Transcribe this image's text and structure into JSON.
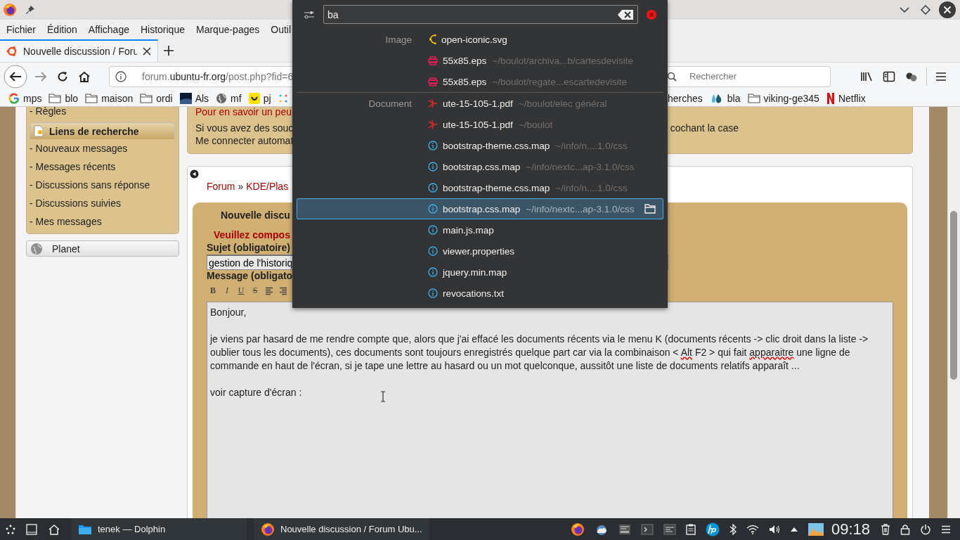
{
  "menu": [
    "Fichier",
    "Édition",
    "Affichage",
    "Historique",
    "Marque-pages",
    "Outil"
  ],
  "tabs": [
    {
      "label": "Nouvelle discussion / Foru",
      "selected": true
    }
  ],
  "address": {
    "prefix": "forum.",
    "host": "ubuntu-fr.org",
    "path": "/post.php?fid=6"
  },
  "search": {
    "placeholder": "Rechercher"
  },
  "bookmarks": {
    "left": [
      {
        "label": "mps",
        "kind": "google"
      },
      {
        "label": "blo",
        "kind": "folder"
      },
      {
        "label": "maison",
        "kind": "folder"
      },
      {
        "label": "ordi",
        "kind": "folder"
      },
      {
        "label": "Als",
        "kind": "image"
      },
      {
        "label": "mf",
        "kind": "globe"
      },
      {
        "label": "pj",
        "kind": "smiley"
      },
      {
        "kind": "app"
      }
    ],
    "right": [
      {
        "label": "herches",
        "kind": "none"
      },
      {
        "label": "bla",
        "kind": "drops"
      },
      {
        "label": "viking-ge345",
        "kind": "folder"
      },
      {
        "label": "Netflix",
        "kind": "netflix"
      }
    ]
  },
  "sidebar": {
    "top_item": "- Règles",
    "header": "Liens de recherche",
    "links": [
      "- Nouveaux messages",
      "- Messages récents",
      "- Discussions sans réponse",
      "- Discussions suivies",
      "- Mes messages"
    ],
    "planet": "Planet"
  },
  "notice": {
    "link": "Pour en savoir un peu",
    "line_1": "Si vous avez des souc",
    "line_1_end": "cochant la case",
    "line_2": "Me connecter automat"
  },
  "breadcrumb": {
    "forum": "Forum",
    "separator": "»",
    "section": "KDE/Plas"
  },
  "form": {
    "title": "Nouvelle discu",
    "warning": "Veuillez compos",
    "subject_label": "Sujet (obligatoire)",
    "subject": "gestion de l'historiq",
    "message_label": "Message (obligato",
    "toolbar": [
      {
        "kind": "bold",
        "label": "B"
      },
      {
        "kind": "italic",
        "label": "I"
      },
      {
        "kind": "underline",
        "label": "U"
      },
      {
        "kind": "strike",
        "label": "S"
      },
      {
        "kind": "align-left"
      },
      {
        "kind": "align-right"
      }
    ],
    "message": [
      [
        {
          "text": "Bonjour,",
          "misspelled": false
        }
      ],
      [
        {
          "text": "je viens par hasard de me rendre compte que, alors que j'ai effacé les documents récents via le menu K (documents récents -> clic droit dans la liste -> oublier tous les documents), ces documents sont toujours enregistrés quelque part car via la combinaison < ",
          "misspelled": false
        },
        {
          "text": "Alt",
          "misspelled": true
        },
        {
          "text": " F2 > qui fait ",
          "misspelled": false
        },
        {
          "text": "apparaitre",
          "misspelled": true
        },
        {
          "text": " une ligne de commande en haut de l'écran, si je tape une lettre au hasard ou un mot quelconque, aussitôt une liste de documents relatifs  apparaît ...",
          "misspelled": false
        }
      ],
      [
        {
          "text": "voir capture d'écran :",
          "misspelled": false
        }
      ]
    ]
  },
  "runner": {
    "query": "ba",
    "groups": [
      {
        "category": "Image",
        "results": [
          {
            "name": "open-iconic.svg",
            "kind": "vector",
            "selected": false
          },
          {
            "name": "55x85.eps",
            "path": "~/boulot/archiva...b/cartesdevisite",
            "kind": "print",
            "selected": false
          },
          {
            "name": "55x85.eps",
            "path": "~/boulot/regate...escartedevisite",
            "kind": "print",
            "selected": false
          }
        ]
      },
      {
        "category": "Document",
        "results": [
          {
            "name": "ute-15-105-1.pdf",
            "path": "~/boulot/elec général",
            "kind": "pdf",
            "selected": false
          },
          {
            "name": "ute-15-105-1.pdf",
            "path": "~/boulot",
            "kind": "pdf",
            "selected": false
          },
          {
            "name": "bootstrap-theme.css.map",
            "path": "~/info/n....1.0/css",
            "kind": "info",
            "selected": false
          },
          {
            "name": "bootstrap.css.map",
            "path": "~/info/nextc...ap-3.1.0/css",
            "kind": "info",
            "selected": false
          },
          {
            "name": "bootstrap-theme.css.map",
            "path": "~/info/n....1.0/css",
            "kind": "info",
            "selected": false
          },
          {
            "name": "bootstrap.css.map",
            "path": "~/info/nextc...ap-3.1.0/css",
            "kind": "info",
            "selected": true
          },
          {
            "name": "main.js.map",
            "kind": "info",
            "selected": false
          },
          {
            "name": "viewer.properties",
            "kind": "info",
            "selected": false
          },
          {
            "name": "jquery.min.map",
            "kind": "info",
            "selected": false
          },
          {
            "name": "revocations.txt",
            "kind": "info",
            "selected": false
          }
        ]
      }
    ]
  },
  "taskbar": {
    "tasks": [
      {
        "label": "tenek — Dolphin",
        "kind": "folder"
      },
      {
        "label": "Nouvelle discussion / Forum Ubu...",
        "kind": "firefox"
      }
    ],
    "clock": "09:18"
  }
}
